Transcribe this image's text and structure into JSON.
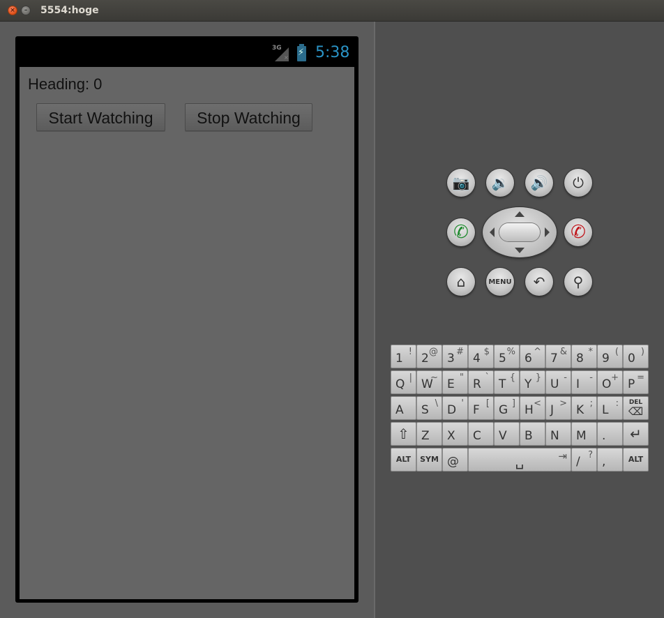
{
  "window": {
    "title": "5554:hoge",
    "close_glyph": "×",
    "minimize_glyph": "–"
  },
  "statusbar": {
    "network": "3G",
    "network_mark": "×",
    "battery_glyph": "⚡",
    "time": "5:38"
  },
  "app": {
    "heading": "Heading: 0",
    "start_button": "Start Watching",
    "stop_button": "Stop Watching"
  },
  "hardware": {
    "camera": "📷",
    "volume_down": "🔉",
    "volume_up": "🔊",
    "power": "⏻",
    "call": "✆",
    "end_call": "✆",
    "home": "⌂",
    "menu": "MENU",
    "back": "↶",
    "search": "⚲"
  },
  "keyboard": {
    "rows": [
      [
        [
          "1",
          "!"
        ],
        [
          "2",
          "@"
        ],
        [
          "3",
          "#"
        ],
        [
          "4",
          "$"
        ],
        [
          "5",
          "%"
        ],
        [
          "6",
          "^"
        ],
        [
          "7",
          "&"
        ],
        [
          "8",
          "*"
        ],
        [
          "9",
          "("
        ],
        [
          "0",
          ")"
        ]
      ],
      [
        [
          "Q",
          "|"
        ],
        [
          "W",
          "~"
        ],
        [
          "E",
          "\""
        ],
        [
          "R",
          "`"
        ],
        [
          "T",
          "{"
        ],
        [
          "Y",
          "}"
        ],
        [
          "U",
          "-"
        ],
        [
          "I",
          "-"
        ],
        [
          "O",
          "+"
        ],
        [
          "P",
          "="
        ]
      ],
      [
        [
          "A",
          ""
        ],
        [
          "S",
          "\\"
        ],
        [
          "D",
          "'"
        ],
        [
          "F",
          "["
        ],
        [
          "G",
          "]"
        ],
        [
          "H",
          "<"
        ],
        [
          "J",
          ">"
        ],
        [
          "K",
          ";"
        ],
        [
          "L",
          ":"
        ]
      ],
      [
        [
          "Z",
          ""
        ],
        [
          "X",
          ""
        ],
        [
          "C",
          ""
        ],
        [
          "V",
          ""
        ],
        [
          "B",
          ""
        ],
        [
          "N",
          ""
        ],
        [
          "M",
          ""
        ],
        [
          ".",
          ""
        ]
      ],
      [
        [
          "@",
          ""
        ],
        [
          "/",
          "?"
        ],
        [
          ",",
          ""
        ]
      ]
    ],
    "del": "DEL",
    "del_icon": "⌫",
    "shift": "⇧",
    "enter": "↵",
    "alt": "ALT",
    "sym": "SYM",
    "space": "␣",
    "tab": "⇥"
  }
}
